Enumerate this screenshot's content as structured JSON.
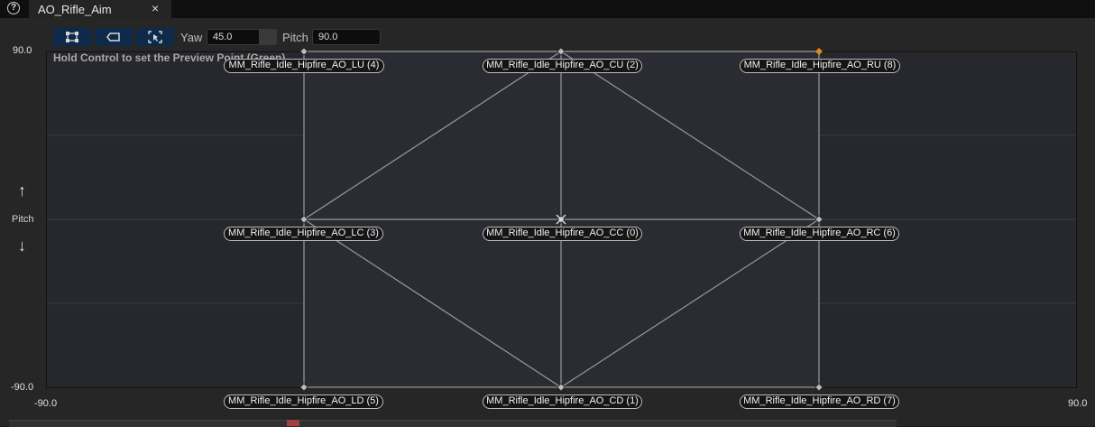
{
  "window": {
    "help_icon": "question-icon",
    "tab_label": "AO_Rifle_Aim",
    "tab_close": "×"
  },
  "toolbar": {
    "buttons": [
      "select-points-icon",
      "display-options-icon",
      "fit-view-icon"
    ],
    "yaw_label": "Yaw",
    "yaw_value": "45.0",
    "pitch_label": "Pitch",
    "pitch_value": "90.0"
  },
  "blendspace": {
    "hint": "Hold Control to set the Preview Point (Green)",
    "y_max": "90.0",
    "y_min": "-90.0",
    "x_min": "-90.0",
    "x_max": "90.0",
    "side_axis_label": "Pitch",
    "up_arrow": "↑",
    "down_arrow": "↓",
    "samples": [
      {
        "name": "MM_Rifle_Idle_Hipfire_AO_LU (4)"
      },
      {
        "name": "MM_Rifle_Idle_Hipfire_AO_CU (2)"
      },
      {
        "name": "MM_Rifle_Idle_Hipfire_AO_RU (8)"
      },
      {
        "name": "MM_Rifle_Idle_Hipfire_AO_LC (3)"
      },
      {
        "name": "MM_Rifle_Idle_Hipfire_AO_CC (0)"
      },
      {
        "name": "MM_Rifle_Idle_Hipfire_AO_RC (6)"
      },
      {
        "name": "MM_Rifle_Idle_Hipfire_AO_LD (5)"
      },
      {
        "name": "MM_Rifle_Idle_Hipfire_AO_CD (1)"
      },
      {
        "name": "MM_Rifle_Idle_Hipfire_AO_RD (7)"
      }
    ],
    "highlight_color": "#e08a1e"
  }
}
